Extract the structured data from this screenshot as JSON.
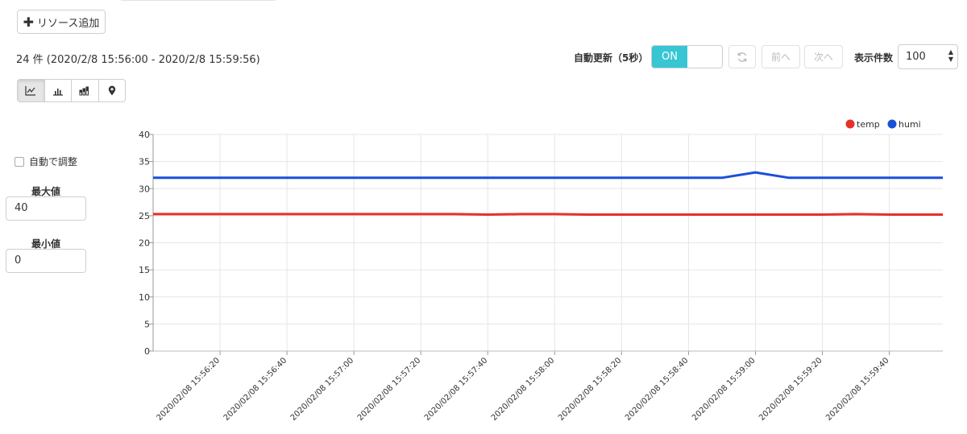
{
  "toolbar": {
    "add_resource_label": "リソース追加",
    "record_range": "24 件 (2020/2/8 15:56:00 - 2020/2/8 15:59:56)",
    "auto_refresh_label": "自動更新（5秒）",
    "auto_refresh_state": "ON",
    "refresh_icon": "refresh-icon",
    "prev_label": "前へ",
    "next_label": "次へ",
    "display_count_label": "表示件数",
    "display_count_value": "100"
  },
  "chart_types": [
    {
      "icon": "line-chart-icon",
      "active": true
    },
    {
      "icon": "bar-chart-icon",
      "active": false
    },
    {
      "icon": "stacked-bar-chart-icon",
      "active": false
    },
    {
      "icon": "map-pin-icon",
      "active": false
    }
  ],
  "side_panel": {
    "auto_adjust_label": "自動で調整",
    "auto_adjust_checked": false,
    "max_label": "最大値",
    "max_value": "40",
    "min_label": "最小値",
    "min_value": "0"
  },
  "colors": {
    "accent_on": "#38c6d3",
    "temp": "#e8302a",
    "humi": "#1a4fd9"
  },
  "chart_data": {
    "type": "line",
    "ylim": [
      0,
      40
    ],
    "yticks": [
      0,
      5,
      10,
      15,
      20,
      25,
      30,
      35,
      40
    ],
    "xlim": [
      "2020/02/08 15:56:00",
      "2020/02/08 15:59:56"
    ],
    "xticks": [
      "2020/02/08 15:56:20",
      "2020/02/08 15:56:40",
      "2020/02/08 15:57:00",
      "2020/02/08 15:57:20",
      "2020/02/08 15:57:40",
      "2020/02/08 15:58:00",
      "2020/02/08 15:58:20",
      "2020/02/08 15:58:40",
      "2020/02/08 15:59:00",
      "2020/02/08 15:59:20",
      "2020/02/08 15:59:40"
    ],
    "legend_position": "top-right",
    "grid": true,
    "x": [
      "15:56:00",
      "15:56:10",
      "15:56:20",
      "15:56:30",
      "15:56:40",
      "15:56:50",
      "15:57:00",
      "15:57:10",
      "15:57:20",
      "15:57:30",
      "15:57:40",
      "15:57:50",
      "15:58:00",
      "15:58:10",
      "15:58:20",
      "15:58:30",
      "15:58:40",
      "15:58:50",
      "15:59:00",
      "15:59:10",
      "15:59:20",
      "15:59:30",
      "15:59:40",
      "15:59:56"
    ],
    "series": [
      {
        "name": "temp",
        "values": [
          25.3,
          25.3,
          25.3,
          25.3,
          25.3,
          25.3,
          25.3,
          25.3,
          25.3,
          25.3,
          25.2,
          25.3,
          25.3,
          25.2,
          25.2,
          25.2,
          25.2,
          25.2,
          25.2,
          25.2,
          25.2,
          25.3,
          25.2,
          25.2
        ]
      },
      {
        "name": "humi",
        "values": [
          32,
          32,
          32,
          32,
          32,
          32,
          32,
          32,
          32,
          32,
          32,
          32,
          32,
          32,
          32,
          32,
          32,
          32,
          33,
          32,
          32,
          32,
          32,
          32
        ]
      }
    ]
  }
}
